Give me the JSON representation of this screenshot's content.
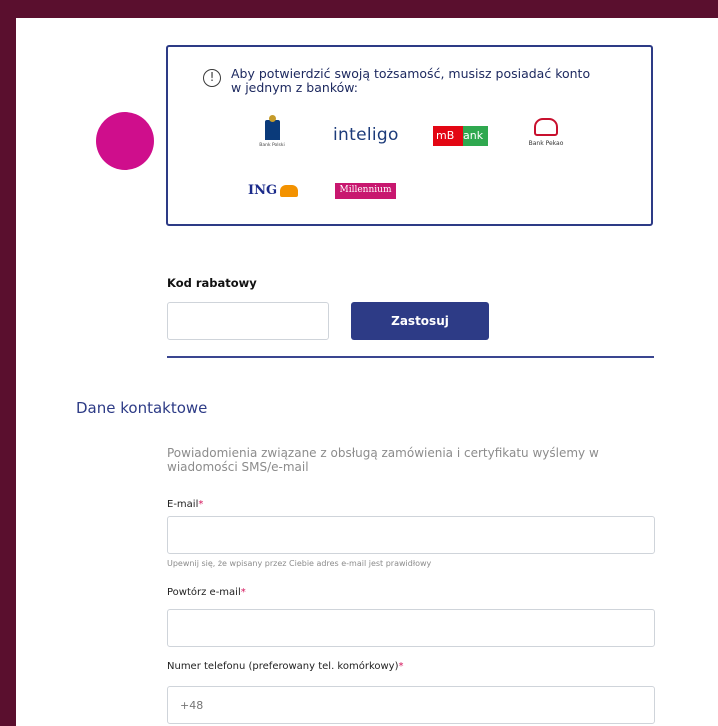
{
  "banks_box": {
    "info_text_line1": "Aby potwierdzić swoją tożsamość, musisz posiadać konto",
    "info_text_line2": "w jednym z banków:",
    "banks": {
      "pko_caption": "Bank Polski",
      "inteligo": "inteligo",
      "mbank_left": "mB",
      "mbank_right": "ank",
      "pekao_caption": "Bank Pekao",
      "ing": "ING",
      "millennium": "Millennium"
    }
  },
  "discount": {
    "label": "Kod rabatowy",
    "input_value": "",
    "apply_label": "Zastosuj"
  },
  "contact": {
    "title": "Dane kontaktowe",
    "notice": "Powiadomienia związane z obsługą zamówienia i certyfikatu wyślemy w wiadomości SMS/e-mail",
    "email_label": "E-mail",
    "email_value": "",
    "email_hint": "Upewnij się, że wpisany przez Ciebie adres e-mail jest prawidłowy",
    "repeat_email_label": "Powtórz e-mail",
    "repeat_email_value": "",
    "phone_label": "Numer telefonu (preferowany tel. komórkowy)",
    "phone_placeholder": "+48",
    "required_mark": "*"
  },
  "colors": {
    "background": "#5a0f2e",
    "accent": "#2d3b86",
    "required": "#d4145a",
    "pink_dot": "#cf0e8c"
  }
}
